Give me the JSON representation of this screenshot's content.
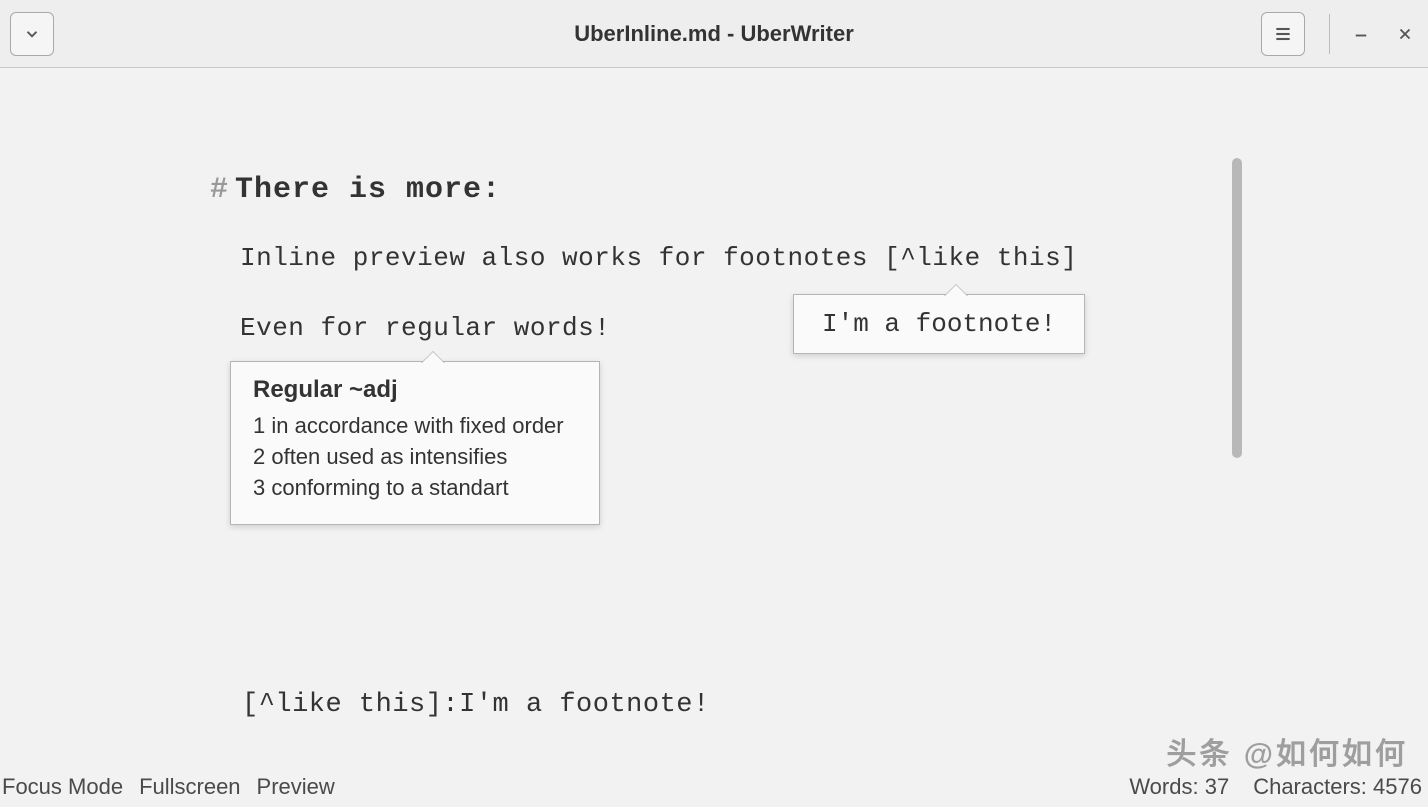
{
  "titlebar": {
    "title": "UberInline.md - UberWriter"
  },
  "document": {
    "heading_marker": "#",
    "heading_text": "There is more:",
    "line1": "Inline preview also works for footnotes [^like this]",
    "line2": "Even for regular words!",
    "footnote_def": "[^like this]:I'm a footnote!"
  },
  "footnote_popup": {
    "text": "I'm a footnote!"
  },
  "definition_popup": {
    "title": "Regular ~adj",
    "items": [
      "1 in accordance with fixed order",
      "2 often used as intensifies",
      "3 conforming to a standart"
    ]
  },
  "statusbar": {
    "focus_mode": "Focus Mode",
    "fullscreen": "Fullscreen",
    "preview": "Preview",
    "words_label": "Words:",
    "words_value": "37",
    "chars_label": "Characters:",
    "chars_value": "4576"
  },
  "watermark": "头条 @如何如何"
}
